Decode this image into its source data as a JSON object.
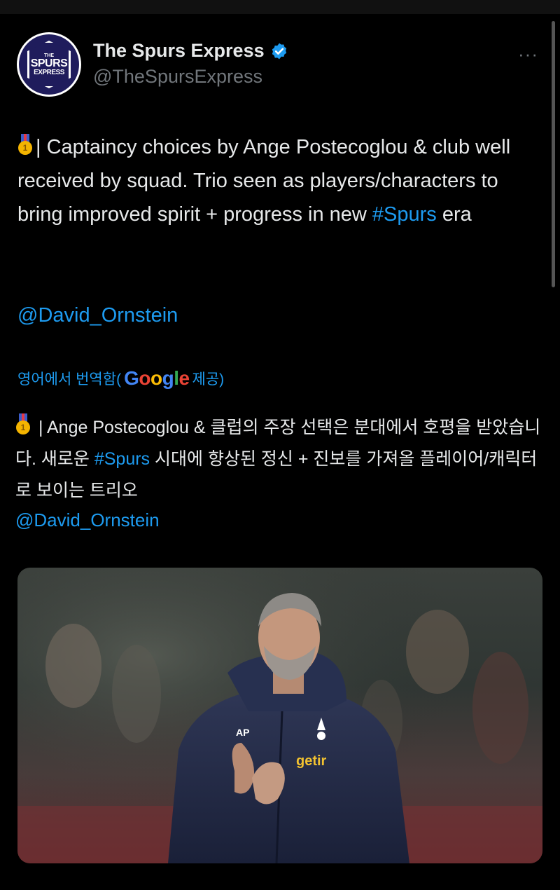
{
  "account": {
    "name": "The Spurs Express",
    "handle": "@TheSpursExpress",
    "avatar_text": {
      "the": "THE",
      "spurs": "SPURS",
      "express": "EXPRESS"
    },
    "more_label": "···"
  },
  "tweet": {
    "medal_digit": "1",
    "text_part1": "| Captaincy choices by Ange Postecoglou & club well received by squad. Trio seen as players/characters to bring improved spirit + progress in new ",
    "hashtag": "#Spurs",
    "text_part2": " era",
    "mention": "@David_Ornstein"
  },
  "translation": {
    "label_prefix": "영어에서 번역함(",
    "google": [
      "G",
      "o",
      "o",
      "g",
      "l",
      "e"
    ],
    "label_suffix": "제공)",
    "text_part1": " | Ange Postecoglou & 클럽의 주장 선택은 분대에서 호평을 받았습니다. 새로운 ",
    "hashtag": "#Spurs",
    "text_part2": " 시대에 향상된 정신 + 진보를 가져올 플레이어/캐릭터로 보이는 트리오",
    "mention": "@David_Ornstein"
  },
  "photo": {
    "jacket_brand": "AP",
    "sponsor": "getir"
  },
  "colors": {
    "background": "#000000",
    "text": "#e7e9ea",
    "secondary": "#71767b",
    "link": "#1d9bf0",
    "verified": "#1d9bf0"
  },
  "icons": [
    "verified-badge-icon",
    "more-icon",
    "medal-icon"
  ]
}
